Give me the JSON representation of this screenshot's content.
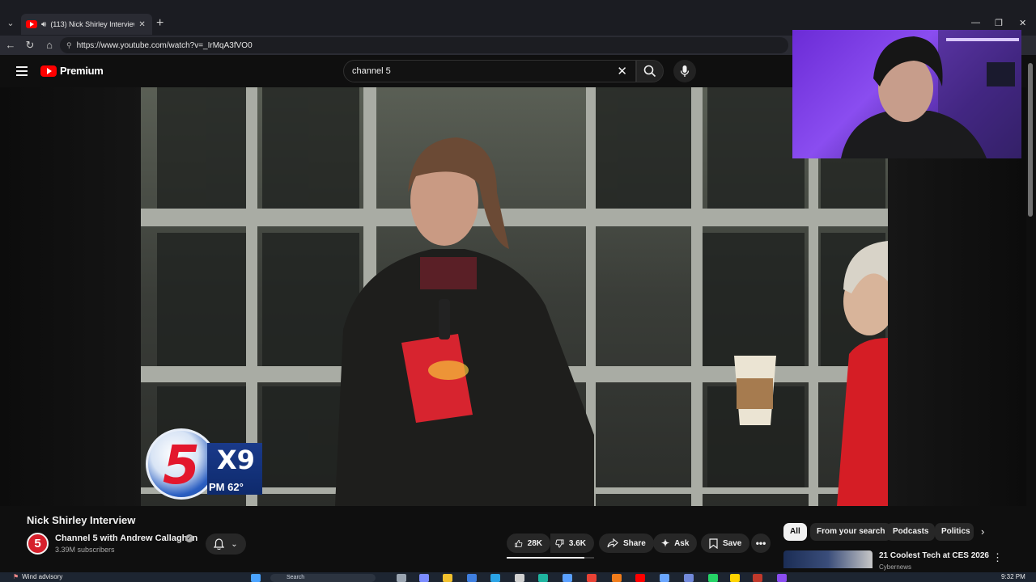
{
  "browser": {
    "tab": {
      "title": "(113) Nick Shirley Interview -",
      "favicon": "youtube-icon",
      "audio_icon": "speaker-icon"
    },
    "url": "https://www.youtube.com/watch?v=_IrMqA3fVO0"
  },
  "youtube": {
    "logo_text": "Premium",
    "search": {
      "query": "channel 5"
    }
  },
  "video": {
    "title": "Nick Shirley Interview",
    "bug": {
      "number": "5",
      "channel_code": "X9",
      "temperature": "PM 62°"
    }
  },
  "channel": {
    "avatar_text": "5",
    "name": "Channel 5 with Andrew Callaghan",
    "verified_icon": "✓",
    "subscribers": "3.39M subscribers"
  },
  "actions": {
    "likes": "28K",
    "dislikes": "3.6K",
    "share": "Share",
    "ask": "Ask",
    "save": "Save",
    "like_ratio": 0.89
  },
  "chips": [
    "All",
    "From your search",
    "Podcasts",
    "Politics"
  ],
  "recommendation": {
    "title": "21 Coolest Tech at CES 2026",
    "channel": "Cybernews"
  },
  "taskbar": {
    "weather": "Wind advisory",
    "search_placeholder": "Search",
    "time": "9:32 PM"
  },
  "colors": {
    "yt_red": "#ff0000",
    "background": "#0f0f0f",
    "chip_bg": "#272727",
    "webcam_purple": "#8a4df0"
  }
}
